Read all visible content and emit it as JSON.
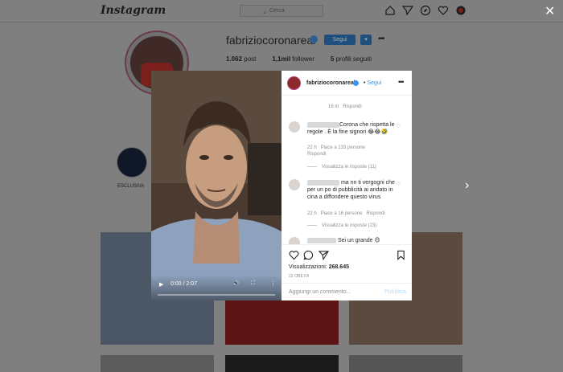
{
  "header": {
    "logo": "Instagram",
    "search_placeholder": "Cerca",
    "icons": [
      "home-icon",
      "direct-icon",
      "explore-icon",
      "activity-icon",
      "profile-icon"
    ]
  },
  "profile": {
    "username": "fabriziocoronareal",
    "follow_label": "Segui",
    "posts": "1.062",
    "posts_label": "post",
    "followers": "1,1mil",
    "followers_label": "follower",
    "following": "5",
    "following_label": "profili seguiti",
    "highlight_label": "ESCLUSIVA"
  },
  "post": {
    "username": "fabriziocoronareal",
    "follow_label": "Segui",
    "video_time": "0:00 / 2:07",
    "first_meta": "16 m",
    "first_reply": "Rispondi",
    "comments": [
      {
        "text": "Corona che rispetta le regole . È la fine signori 😂😂🤣",
        "time": "22 h",
        "likes": "Piace a 133 persone",
        "reply": "Rispondi",
        "view_replies": "Visualizza le risposte (11)"
      },
      {
        "text": "ma nn ti vergogni che per un po di pubblicità ai andato in cina a diffondere questo virus",
        "time": "22 h",
        "likes": "Piace a 16 persone",
        "reply": "Rispondi",
        "view_replies": "Visualizza le risposte (23)"
      },
      {
        "text": "Sei un grande 😍"
      }
    ],
    "views_label": "Visualizzazioni:",
    "views_count": "268.645",
    "time_ago": "22 ORE FA",
    "comment_placeholder": "Aggiungi un commento...",
    "publish_label": "Pubblica"
  },
  "colors": {
    "overlay": "#7f7f7f",
    "accent_blue": "#3897f0",
    "publish_disabled": "#b2dffc"
  }
}
